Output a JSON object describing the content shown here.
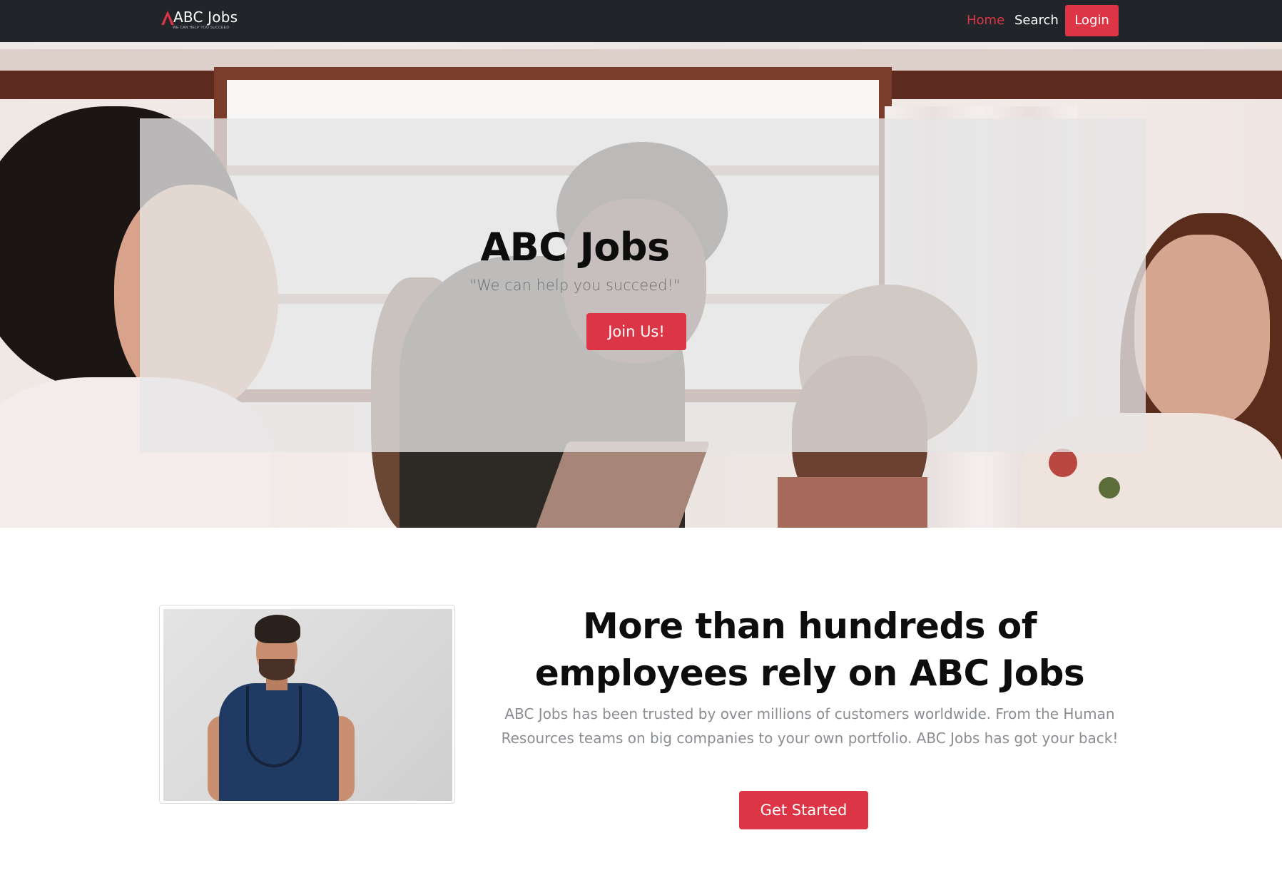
{
  "navbar": {
    "brand": "ABC Jobs",
    "brand_tagline": "WE CAN HELP YOU SUCCEED",
    "links": [
      {
        "label": "Home",
        "active": true
      },
      {
        "label": "Search",
        "active": false
      }
    ],
    "login_label": "Login"
  },
  "hero": {
    "title": "ABC Jobs",
    "subtitle": "\"We can help you succeed!\"",
    "cta_label": "Join Us!"
  },
  "feature": {
    "title_line1": "More than hundreds of",
    "title_line2": "employees rely on ABC Jobs",
    "text": "ABC Jobs has been trusted by over millions of customers worldwide. From the Human Resources teams on big companies to your own portfolio. ABC Jobs has got your back!",
    "cta_label": "Get Started"
  },
  "colors": {
    "navbar_bg": "#212529",
    "accent": "#dc3545",
    "nav_active": "#dc3545",
    "text_dark": "#0d0d0d",
    "text_muted": "#8a8d91"
  },
  "icons": {
    "brand_logo": "abc-jobs-logo-icon"
  }
}
